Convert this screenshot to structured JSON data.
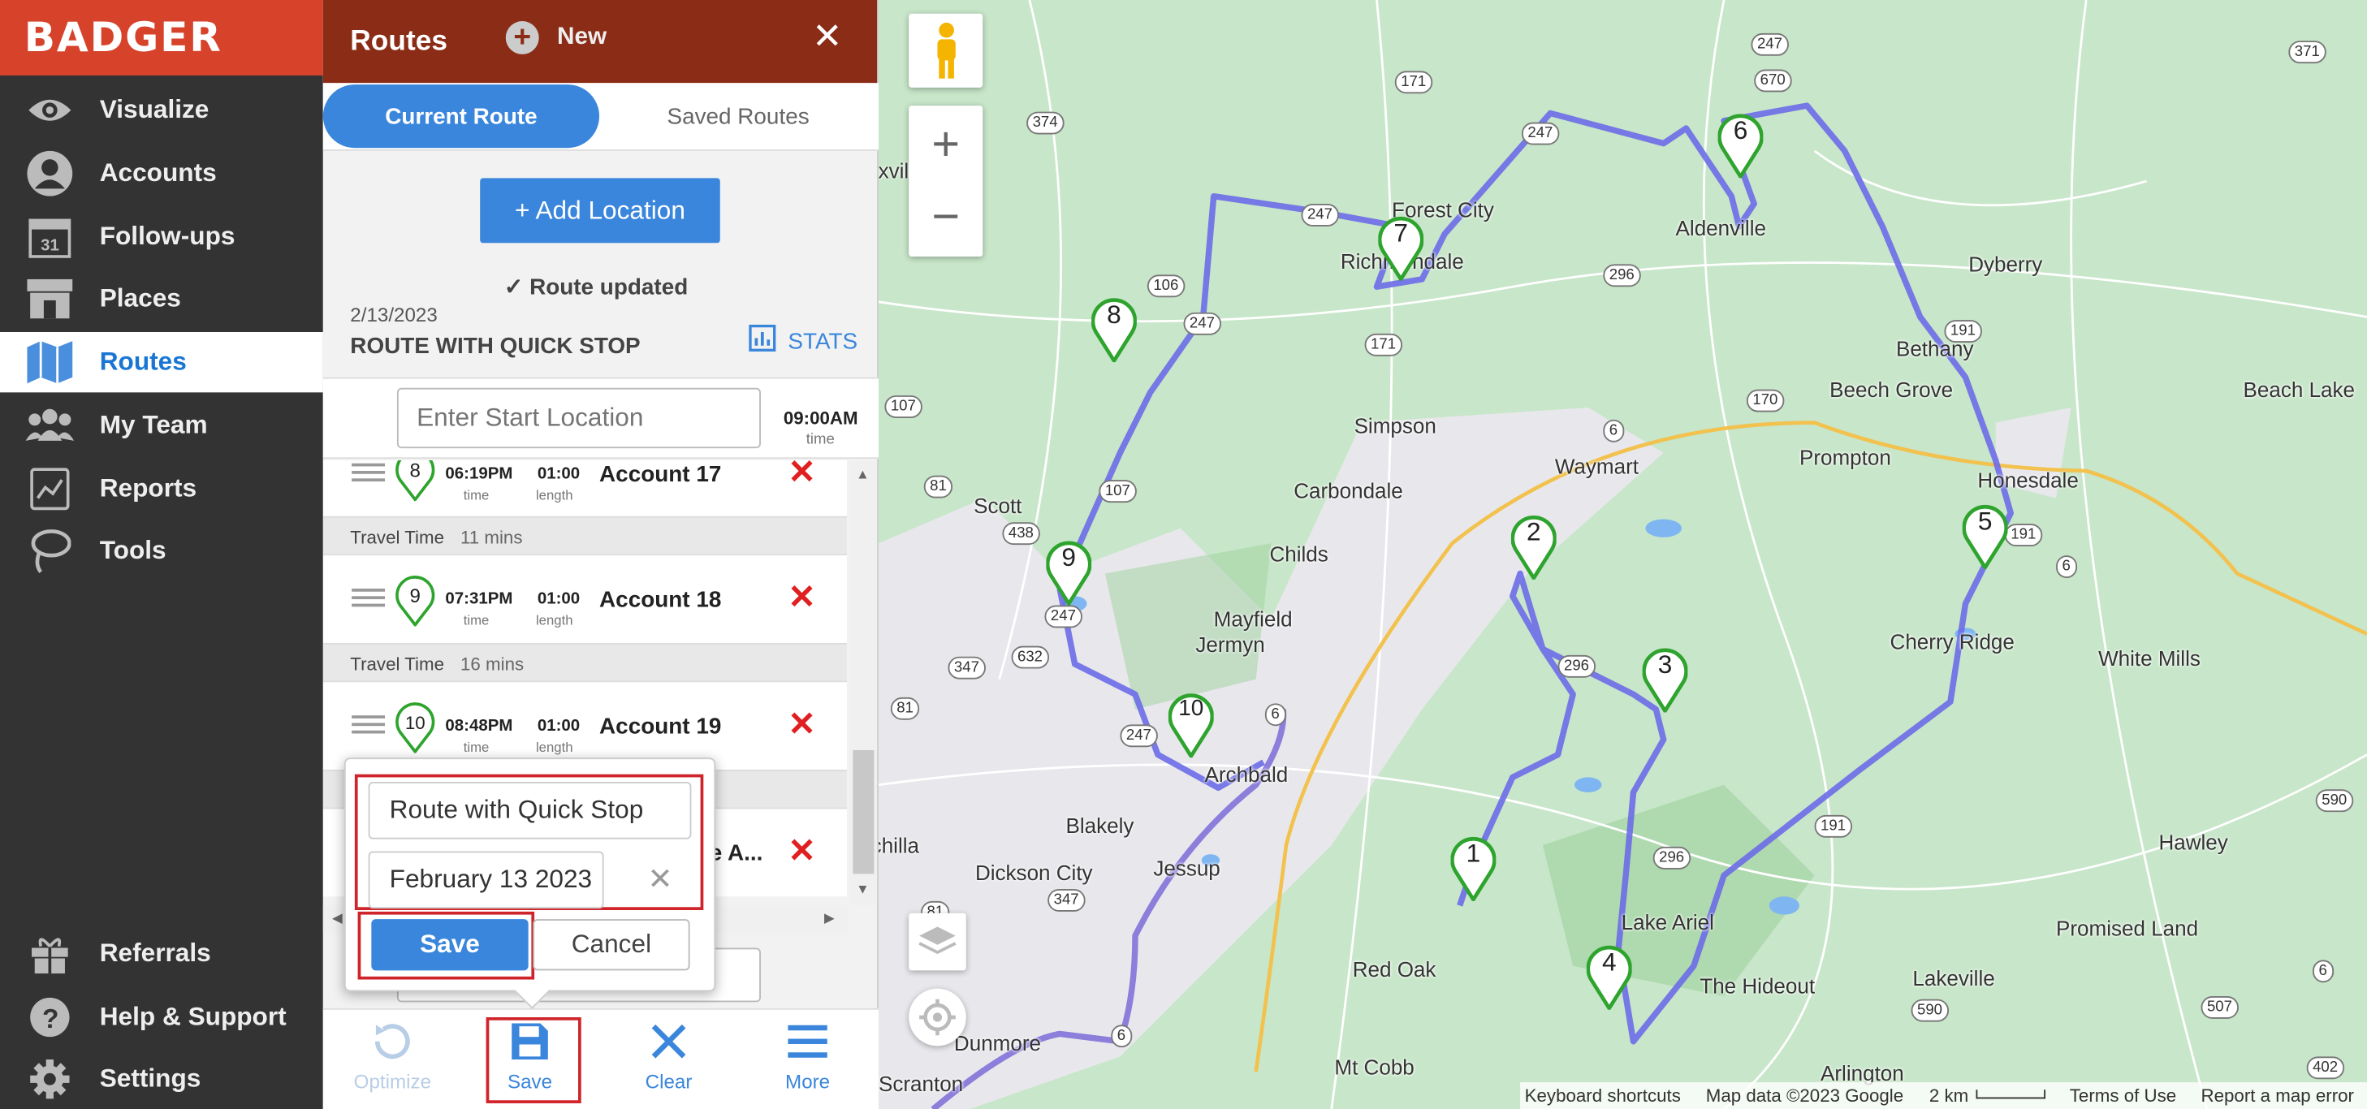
{
  "app": {
    "name": "BADGER"
  },
  "sidebar": {
    "items": [
      {
        "label": "Visualize",
        "icon": "eye-icon"
      },
      {
        "label": "Accounts",
        "icon": "person-icon"
      },
      {
        "label": "Follow-ups",
        "icon": "calendar-icon",
        "icon_text": "31"
      },
      {
        "label": "Places",
        "icon": "storefront-icon"
      },
      {
        "label": "Routes",
        "icon": "route-map-icon",
        "active": true
      },
      {
        "label": "My Team",
        "icon": "team-icon"
      },
      {
        "label": "Reports",
        "icon": "reports-icon"
      },
      {
        "label": "Tools",
        "icon": "lasso-icon"
      },
      {
        "label": "Referrals",
        "icon": "gift-icon"
      },
      {
        "label": "Help & Support",
        "icon": "help-icon"
      },
      {
        "label": "Settings",
        "icon": "gear-icon"
      }
    ]
  },
  "panel": {
    "title": "Routes",
    "new_label": "New",
    "tabs": [
      "Current Route",
      "Saved Routes"
    ],
    "add_location": "+ Add Location",
    "route_updated": "Route updated",
    "route_date": "2/13/2023",
    "route_name": "ROUTE WITH QUICK STOP",
    "stats_label": "STATS",
    "start_placeholder": "Enter Start Location",
    "start_time": "09:00AM",
    "start_time_label": "time",
    "stops": [
      {
        "num": "8",
        "time": "06:19PM",
        "length": "01:00",
        "account": "Account 17"
      },
      {
        "num": "9",
        "time": "07:31PM",
        "length": "01:00",
        "account": "Account 18"
      },
      {
        "num": "10",
        "time": "08:48PM",
        "length": "01:00",
        "account": "Account 19"
      },
      {
        "num": "",
        "time": "",
        "length": "",
        "account": "e A..."
      }
    ],
    "time_label": "time",
    "length_label": "length",
    "travel": [
      {
        "label": "Travel Time",
        "value": "11 mins"
      },
      {
        "label": "Travel Time",
        "value": "16 mins"
      }
    ],
    "bottom": [
      {
        "label": "Optimize",
        "icon": "optimize-icon"
      },
      {
        "label": "Save",
        "icon": "floppy-disk-icon"
      },
      {
        "label": "Clear",
        "icon": "close-icon"
      },
      {
        "label": "More",
        "icon": "hamburger-menu-icon"
      }
    ]
  },
  "popup": {
    "name_value": "Route with Quick Stop",
    "date_value": "February 13 2023",
    "save_label": "Save",
    "cancel_label": "Cancel"
  },
  "map": {
    "places": [
      "oxville",
      "Forest City",
      "Richmondale",
      "Aldenville",
      "Dyberry",
      "Bethany",
      "Beech Grove",
      "Beach Lake",
      "Simpson",
      "Prompton",
      "Waymart",
      "Scott",
      "Carbondale",
      "Honesdale",
      "Childs",
      "Mayfield",
      "Jermyn",
      "Cherry Ridge",
      "White Mills",
      "Archbald",
      "Blakely",
      "Dickson City",
      "Jessup",
      "chilla",
      "Hawley",
      "Lake Ariel",
      "Promised Land",
      "Red Oak",
      "The Hideout",
      "Lakeville",
      "Dunmore",
      "Scranton",
      "Mt Cobb",
      "Arlington"
    ],
    "routes": [
      "374",
      "171",
      "247",
      "670",
      "371",
      "106",
      "296",
      "191",
      "107",
      "170",
      "6",
      "81",
      "438",
      "632",
      "347",
      "590",
      "507",
      "402"
    ],
    "markers": [
      "1",
      "2",
      "3",
      "4",
      "5",
      "6",
      "7",
      "8",
      "9",
      "10"
    ],
    "attribution": {
      "shortcuts": "Keyboard shortcuts",
      "data": "Map data ©2023 Google",
      "scale": "2 km",
      "terms": "Terms of Use",
      "report": "Report a map error"
    },
    "colors": {
      "route": "#6b6be8",
      "marker_fill": "#ffffff",
      "marker_stroke": "#2ea42e",
      "marker_red": "#e2452f"
    }
  }
}
